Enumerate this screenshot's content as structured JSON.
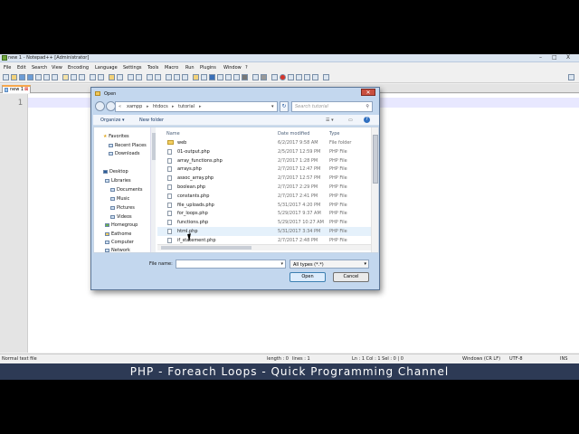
{
  "app": {
    "title": "new 1 - Notepad++ [Administrator]",
    "menu": [
      "File",
      "Edit",
      "Search",
      "View",
      "Encoding",
      "Language",
      "Settings",
      "Tools",
      "Macro",
      "Run",
      "Plugins",
      "Window",
      "?"
    ],
    "tab_label": "new 1",
    "line_number": "1",
    "window_close": "X"
  },
  "statusbar": {
    "file_type": "Normal text file",
    "length": "length : 0",
    "lines": "lines : 1",
    "position": "Ln : 1    Col : 1    Sel : 0 | 0",
    "eol": "Windows (CR LF)",
    "encoding": "UTF-8",
    "mode": "INS"
  },
  "caption": "PHP - Foreach Loops - Quick Programming Channel",
  "dialog": {
    "title": "Open",
    "close": "✕",
    "address": [
      "xampp",
      "htdocs",
      "tutorial"
    ],
    "search_placeholder": "Search tutorial",
    "organize": "Organize ▾",
    "new_folder": "New folder",
    "nav": {
      "favorites": "Favorites",
      "recent_places": "Recent Places",
      "downloads": "Downloads",
      "desktop": "Desktop",
      "libraries": "Libraries",
      "documents": "Documents",
      "music": "Music",
      "pictures": "Pictures",
      "videos": "Videos",
      "homegroup": "Homegroup",
      "user": "Eathome",
      "computer": "Computer",
      "network": "Network"
    },
    "columns": {
      "name": "Name",
      "date": "Date modified",
      "type": "Type"
    },
    "files": [
      {
        "name": "web",
        "date": "6/2/2017 9:58 AM",
        "type": "File folder",
        "folder": true
      },
      {
        "name": "01-output.php",
        "date": "2/5/2017 12:59 PM",
        "type": "PHP File"
      },
      {
        "name": "array_functions.php",
        "date": "2/7/2017 1:28 PM",
        "type": "PHP File"
      },
      {
        "name": "arrays.php",
        "date": "2/7/2017 12:47 PM",
        "type": "PHP File"
      },
      {
        "name": "assoc_array.php",
        "date": "2/7/2017 12:57 PM",
        "type": "PHP File"
      },
      {
        "name": "boolean.php",
        "date": "2/7/2017 2:29 PM",
        "type": "PHP File"
      },
      {
        "name": "constants.php",
        "date": "2/7/2017 2:41 PM",
        "type": "PHP File"
      },
      {
        "name": "file_uploads.php",
        "date": "5/31/2017 4:20 PM",
        "type": "PHP File"
      },
      {
        "name": "for_loops.php",
        "date": "5/29/2017 9:37 AM",
        "type": "PHP File"
      },
      {
        "name": "functions.php",
        "date": "5/29/2017 10:27 AM",
        "type": "PHP File"
      },
      {
        "name": "html.php",
        "date": "5/31/2017 3:34 PM",
        "type": "PHP File"
      },
      {
        "name": "if_statement.php",
        "date": "2/7/2017 2:48 PM",
        "type": "PHP File"
      }
    ],
    "file_name_label": "File name:",
    "file_name_value": "",
    "file_type_selected": "All types (*.*)",
    "open_button": "Open",
    "cancel_button": "Cancel"
  }
}
